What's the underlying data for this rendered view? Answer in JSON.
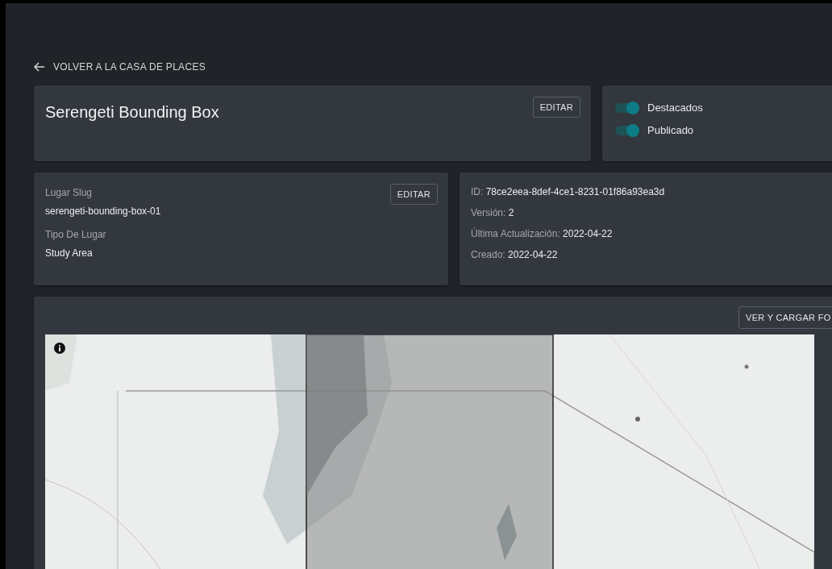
{
  "back_link": {
    "label": "VOLVER A LA CASA DE PLACES"
  },
  "title_card": {
    "title": "Serengeti Bounding Box",
    "edit_button": "EDITAR"
  },
  "toggles": [
    {
      "label": "Destacados",
      "on": true
    },
    {
      "label": "Publicado",
      "on": true
    }
  ],
  "details_card": {
    "fields": [
      {
        "label": "Lugar Slug",
        "value": "serengeti-bounding-box-01"
      },
      {
        "label": "Tipo De Lugar",
        "value": "Study Area"
      }
    ],
    "edit_button": "EDITAR"
  },
  "meta_card": {
    "rows": [
      {
        "label": "ID:",
        "value": "78ce2eea-8def-4ce1-8231-01f86a93ea3d"
      },
      {
        "label": "Versión:",
        "value": "2"
      },
      {
        "label": "Última Actualización:",
        "value": "2022-04-22"
      },
      {
        "label": "Creado:",
        "value": "2022-04-22"
      }
    ]
  },
  "map_card": {
    "button": "VER Y CARGAR FO"
  }
}
